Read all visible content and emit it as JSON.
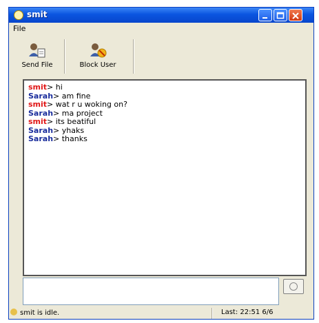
{
  "window": {
    "title": "smit"
  },
  "menu": {
    "file": "File"
  },
  "toolbar": {
    "send_file": "Send File",
    "block_user": "Block User"
  },
  "chat": {
    "messages": [
      {
        "nick": "smit",
        "sep": ">",
        "text": " hi"
      },
      {
        "nick": "Sarah",
        "sep": ">",
        "text": " am fine"
      },
      {
        "nick": "smit",
        "sep": ">",
        "text": " wat r u woking on?"
      },
      {
        "nick": "Sarah",
        "sep": ">",
        "text": " ma project"
      },
      {
        "nick": "smit",
        "sep": ">",
        "text": " its beatiful"
      },
      {
        "nick": "Sarah",
        "sep": ">",
        "text": " yhaks"
      },
      {
        "nick": "Sarah",
        "sep": ">",
        "text": " thanks"
      }
    ]
  },
  "input": {
    "value": ""
  },
  "status": {
    "left": "smit is idle.",
    "right": "Last: 22:51 6/6"
  },
  "colors": {
    "nick_smit": "#e01818",
    "nick_sarah": "#1a2d9c",
    "titlebar": "#0a55e0"
  }
}
